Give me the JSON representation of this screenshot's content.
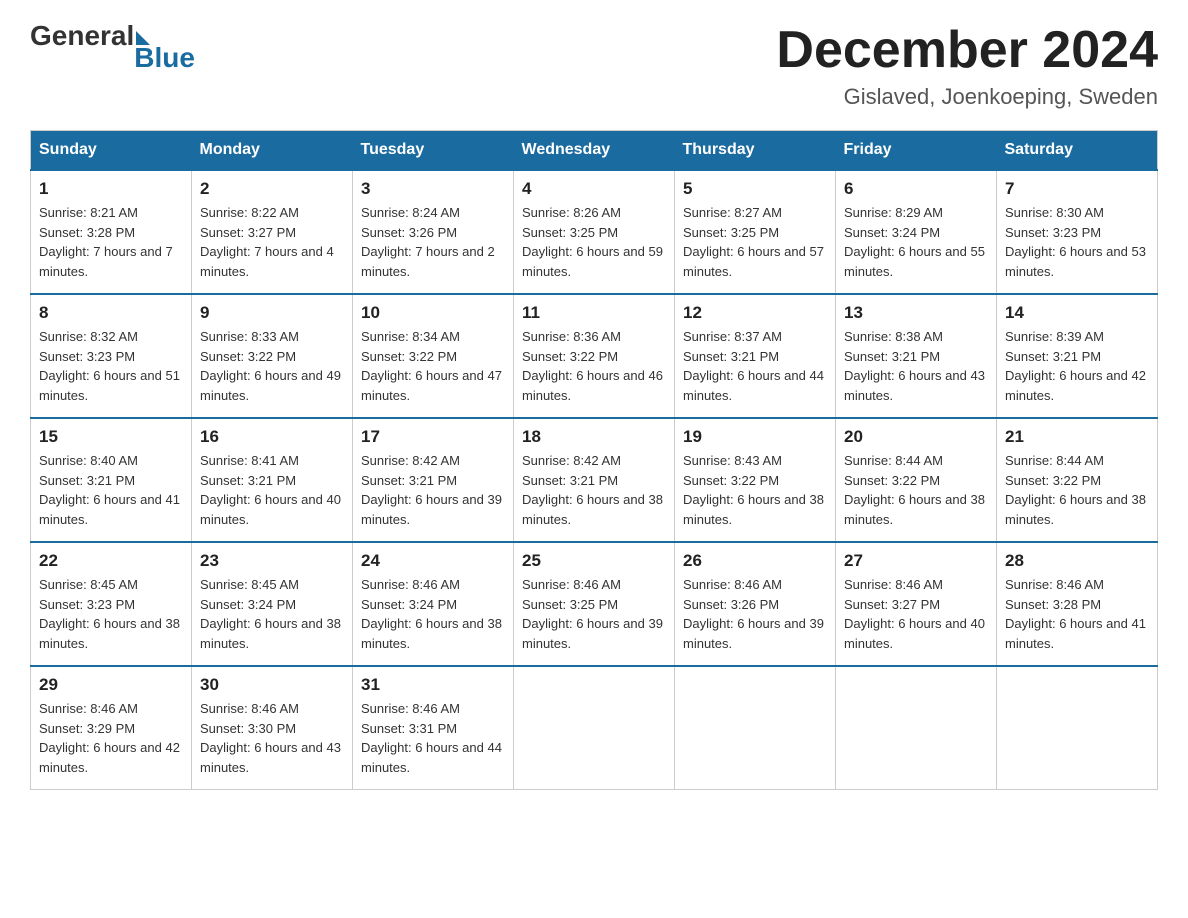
{
  "header": {
    "logo_general": "General",
    "logo_blue": "Blue",
    "month_title": "December 2024",
    "location": "Gislaved, Joenkoeping, Sweden"
  },
  "days_of_week": [
    "Sunday",
    "Monday",
    "Tuesday",
    "Wednesday",
    "Thursday",
    "Friday",
    "Saturday"
  ],
  "weeks": [
    [
      {
        "day": "1",
        "sunrise": "8:21 AM",
        "sunset": "3:28 PM",
        "daylight": "7 hours and 7 minutes."
      },
      {
        "day": "2",
        "sunrise": "8:22 AM",
        "sunset": "3:27 PM",
        "daylight": "7 hours and 4 minutes."
      },
      {
        "day": "3",
        "sunrise": "8:24 AM",
        "sunset": "3:26 PM",
        "daylight": "7 hours and 2 minutes."
      },
      {
        "day": "4",
        "sunrise": "8:26 AM",
        "sunset": "3:25 PM",
        "daylight": "6 hours and 59 minutes."
      },
      {
        "day": "5",
        "sunrise": "8:27 AM",
        "sunset": "3:25 PM",
        "daylight": "6 hours and 57 minutes."
      },
      {
        "day": "6",
        "sunrise": "8:29 AM",
        "sunset": "3:24 PM",
        "daylight": "6 hours and 55 minutes."
      },
      {
        "day": "7",
        "sunrise": "8:30 AM",
        "sunset": "3:23 PM",
        "daylight": "6 hours and 53 minutes."
      }
    ],
    [
      {
        "day": "8",
        "sunrise": "8:32 AM",
        "sunset": "3:23 PM",
        "daylight": "6 hours and 51 minutes."
      },
      {
        "day": "9",
        "sunrise": "8:33 AM",
        "sunset": "3:22 PM",
        "daylight": "6 hours and 49 minutes."
      },
      {
        "day": "10",
        "sunrise": "8:34 AM",
        "sunset": "3:22 PM",
        "daylight": "6 hours and 47 minutes."
      },
      {
        "day": "11",
        "sunrise": "8:36 AM",
        "sunset": "3:22 PM",
        "daylight": "6 hours and 46 minutes."
      },
      {
        "day": "12",
        "sunrise": "8:37 AM",
        "sunset": "3:21 PM",
        "daylight": "6 hours and 44 minutes."
      },
      {
        "day": "13",
        "sunrise": "8:38 AM",
        "sunset": "3:21 PM",
        "daylight": "6 hours and 43 minutes."
      },
      {
        "day": "14",
        "sunrise": "8:39 AM",
        "sunset": "3:21 PM",
        "daylight": "6 hours and 42 minutes."
      }
    ],
    [
      {
        "day": "15",
        "sunrise": "8:40 AM",
        "sunset": "3:21 PM",
        "daylight": "6 hours and 41 minutes."
      },
      {
        "day": "16",
        "sunrise": "8:41 AM",
        "sunset": "3:21 PM",
        "daylight": "6 hours and 40 minutes."
      },
      {
        "day": "17",
        "sunrise": "8:42 AM",
        "sunset": "3:21 PM",
        "daylight": "6 hours and 39 minutes."
      },
      {
        "day": "18",
        "sunrise": "8:42 AM",
        "sunset": "3:21 PM",
        "daylight": "6 hours and 38 minutes."
      },
      {
        "day": "19",
        "sunrise": "8:43 AM",
        "sunset": "3:22 PM",
        "daylight": "6 hours and 38 minutes."
      },
      {
        "day": "20",
        "sunrise": "8:44 AM",
        "sunset": "3:22 PM",
        "daylight": "6 hours and 38 minutes."
      },
      {
        "day": "21",
        "sunrise": "8:44 AM",
        "sunset": "3:22 PM",
        "daylight": "6 hours and 38 minutes."
      }
    ],
    [
      {
        "day": "22",
        "sunrise": "8:45 AM",
        "sunset": "3:23 PM",
        "daylight": "6 hours and 38 minutes."
      },
      {
        "day": "23",
        "sunrise": "8:45 AM",
        "sunset": "3:24 PM",
        "daylight": "6 hours and 38 minutes."
      },
      {
        "day": "24",
        "sunrise": "8:46 AM",
        "sunset": "3:24 PM",
        "daylight": "6 hours and 38 minutes."
      },
      {
        "day": "25",
        "sunrise": "8:46 AM",
        "sunset": "3:25 PM",
        "daylight": "6 hours and 39 minutes."
      },
      {
        "day": "26",
        "sunrise": "8:46 AM",
        "sunset": "3:26 PM",
        "daylight": "6 hours and 39 minutes."
      },
      {
        "day": "27",
        "sunrise": "8:46 AM",
        "sunset": "3:27 PM",
        "daylight": "6 hours and 40 minutes."
      },
      {
        "day": "28",
        "sunrise": "8:46 AM",
        "sunset": "3:28 PM",
        "daylight": "6 hours and 41 minutes."
      }
    ],
    [
      {
        "day": "29",
        "sunrise": "8:46 AM",
        "sunset": "3:29 PM",
        "daylight": "6 hours and 42 minutes."
      },
      {
        "day": "30",
        "sunrise": "8:46 AM",
        "sunset": "3:30 PM",
        "daylight": "6 hours and 43 minutes."
      },
      {
        "day": "31",
        "sunrise": "8:46 AM",
        "sunset": "3:31 PM",
        "daylight": "6 hours and 44 minutes."
      },
      null,
      null,
      null,
      null
    ]
  ]
}
